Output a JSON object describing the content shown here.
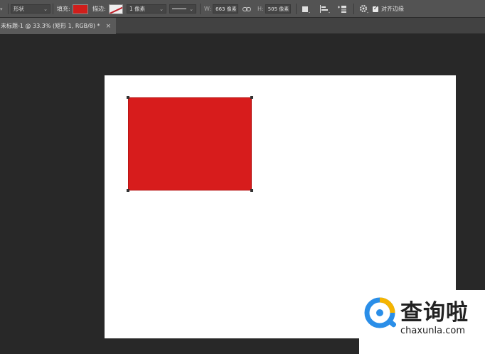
{
  "options_bar": {
    "mode_dropdown": "形状",
    "fill_label": "填充:",
    "fill_color": "#d01e1b",
    "stroke_label": "描边:",
    "stroke_width": "1 像素",
    "w_label": "W:",
    "w_value": "663 像素",
    "link_icon": "link-icon",
    "h_label": "H:",
    "h_value": "505 像素",
    "align_edges_checked": true,
    "align_edges_label": "对齐边缘"
  },
  "document_tab": {
    "title": "未标题-1 @ 33.3% (矩形 1, RGB/8) *",
    "close": "×"
  },
  "canvas": {
    "document_bg": "#ffffff",
    "shape_color": "#d71c1c"
  },
  "watermark": {
    "chinese": "查询啦",
    "url": "chaxunla.com"
  }
}
